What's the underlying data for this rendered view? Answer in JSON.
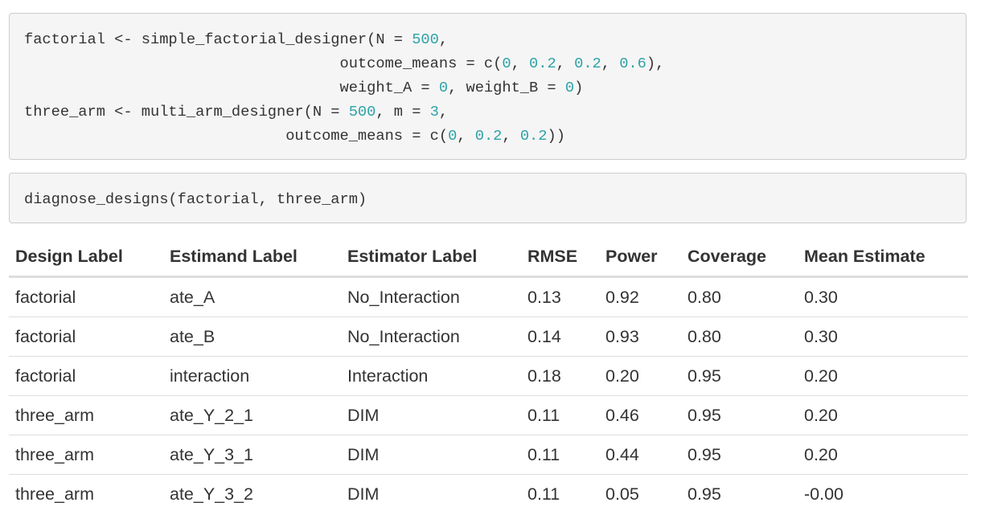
{
  "code_blocks": [
    {
      "lines": [
        [
          {
            "t": "factorial <- simple_factorial_designer(N = "
          },
          {
            "t": "500",
            "num": true
          },
          {
            "t": ","
          }
        ],
        [
          {
            "t": "                                   outcome_means = c("
          },
          {
            "t": "0",
            "num": true
          },
          {
            "t": ", "
          },
          {
            "t": "0.2",
            "num": true
          },
          {
            "t": ", "
          },
          {
            "t": "0.2",
            "num": true
          },
          {
            "t": ", "
          },
          {
            "t": "0.6",
            "num": true
          },
          {
            "t": "),"
          }
        ],
        [
          {
            "t": "                                   weight_A = "
          },
          {
            "t": "0",
            "num": true
          },
          {
            "t": ", weight_B = "
          },
          {
            "t": "0",
            "num": true
          },
          {
            "t": ")"
          }
        ],
        [
          {
            "t": "three_arm <- multi_arm_designer(N = "
          },
          {
            "t": "500",
            "num": true
          },
          {
            "t": ", m = "
          },
          {
            "t": "3",
            "num": true
          },
          {
            "t": ","
          }
        ],
        [
          {
            "t": "                             outcome_means = c("
          },
          {
            "t": "0",
            "num": true
          },
          {
            "t": ", "
          },
          {
            "t": "0.2",
            "num": true
          },
          {
            "t": ", "
          },
          {
            "t": "0.2",
            "num": true
          },
          {
            "t": "))"
          }
        ]
      ]
    },
    {
      "lines": [
        [
          {
            "t": "diagnose_designs(factorial, three_arm)"
          }
        ]
      ]
    }
  ],
  "colors": {
    "code_number": "#2ea2a8",
    "code_text": "#333333",
    "code_background": "#f5f5f5",
    "code_border": "#cccccc",
    "table_text": "#333333",
    "table_rule": "#dddddd"
  },
  "table": {
    "headers": [
      "Design Label",
      "Estimand Label",
      "Estimator Label",
      "RMSE",
      "Power",
      "Coverage",
      "Mean Estimate"
    ],
    "rows": [
      [
        "factorial",
        "ate_A",
        "No_Interaction",
        "0.13",
        "0.92",
        "0.80",
        "0.30"
      ],
      [
        "factorial",
        "ate_B",
        "No_Interaction",
        "0.14",
        "0.93",
        "0.80",
        "0.30"
      ],
      [
        "factorial",
        "interaction",
        "Interaction",
        "0.18",
        "0.20",
        "0.95",
        "0.20"
      ],
      [
        "three_arm",
        "ate_Y_2_1",
        "DIM",
        "0.11",
        "0.46",
        "0.95",
        "0.20"
      ],
      [
        "three_arm",
        "ate_Y_3_1",
        "DIM",
        "0.11",
        "0.44",
        "0.95",
        "0.20"
      ],
      [
        "three_arm",
        "ate_Y_3_2",
        "DIM",
        "0.11",
        "0.05",
        "0.95",
        "-0.00"
      ]
    ]
  }
}
